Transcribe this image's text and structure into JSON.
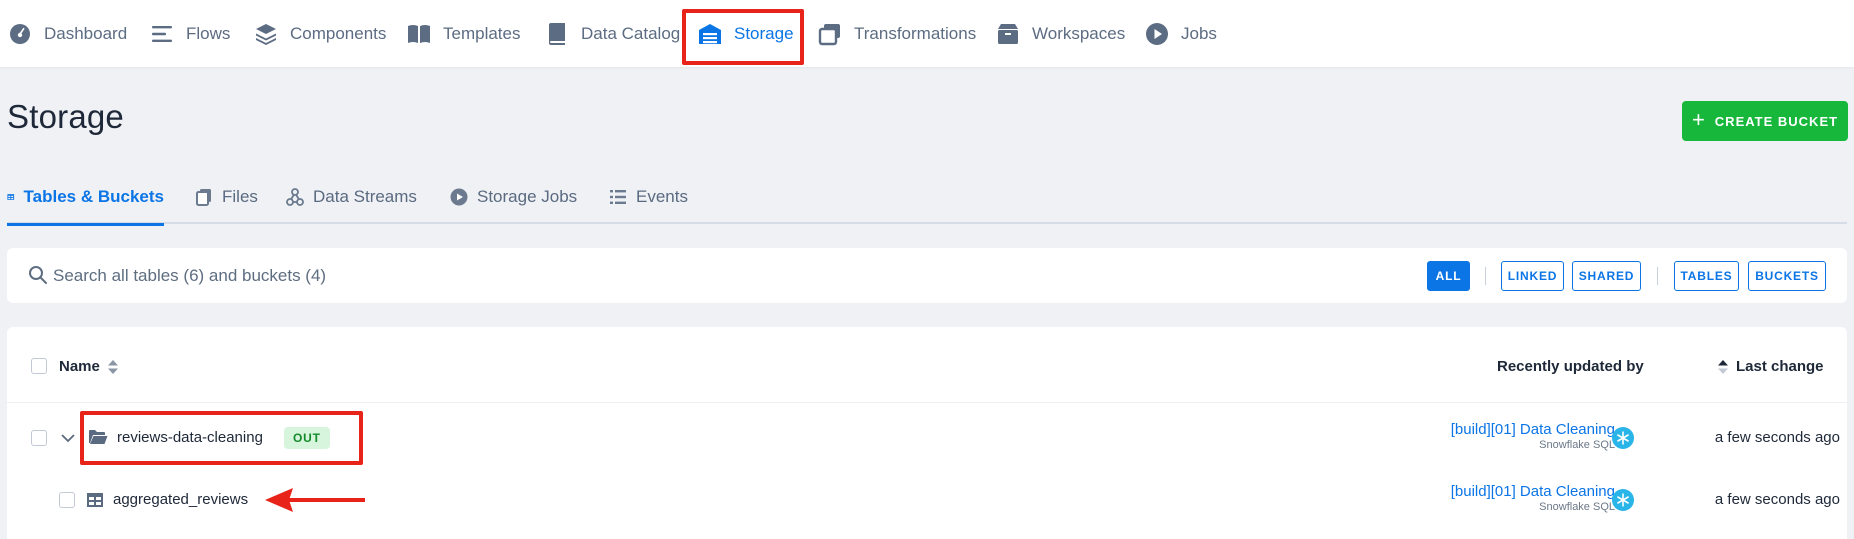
{
  "nav": {
    "items": [
      {
        "label": "Dashboard",
        "icon": "dashboard-icon"
      },
      {
        "label": "Flows",
        "icon": "flows-icon"
      },
      {
        "label": "Components",
        "icon": "components-icon"
      },
      {
        "label": "Templates",
        "icon": "templates-icon"
      },
      {
        "label": "Data Catalog",
        "icon": "data-catalog-icon"
      },
      {
        "label": "Storage",
        "icon": "storage-icon",
        "active": true
      },
      {
        "label": "Transformations",
        "icon": "transformations-icon"
      },
      {
        "label": "Workspaces",
        "icon": "workspaces-icon"
      },
      {
        "label": "Jobs",
        "icon": "jobs-icon"
      }
    ]
  },
  "page": {
    "title": "Storage",
    "create_button": "CREATE BUCKET"
  },
  "subtabs": [
    {
      "label": "Tables & Buckets",
      "active": true
    },
    {
      "label": "Files"
    },
    {
      "label": "Data Streams"
    },
    {
      "label": "Storage Jobs"
    },
    {
      "label": "Events"
    }
  ],
  "search": {
    "placeholder": "Search all tables (6) and buckets (4)",
    "filters": {
      "all": "ALL",
      "linked": "LINKED",
      "shared": "SHARED",
      "tables": "TABLES",
      "buckets": "BUCKETS"
    },
    "active_filter": "ALL"
  },
  "table": {
    "columns": {
      "name": "Name",
      "updated_by": "Recently updated by",
      "last_change": "Last change"
    },
    "rows": [
      {
        "type": "bucket",
        "name": "reviews-data-cleaning",
        "badge": "OUT",
        "updated_by": "[build][01] Data Cleaning",
        "updated_by_sub": "Snowflake SQL",
        "last_change": "a few seconds ago"
      },
      {
        "type": "table",
        "name": "aggregated_reviews",
        "updated_by": "[build][01] Data Cleaning",
        "updated_by_sub": "Snowflake SQL",
        "last_change": "a few seconds ago"
      }
    ]
  },
  "colors": {
    "accent": "#0b75e6",
    "create": "#16b73b",
    "annotation": "#e8231a"
  }
}
